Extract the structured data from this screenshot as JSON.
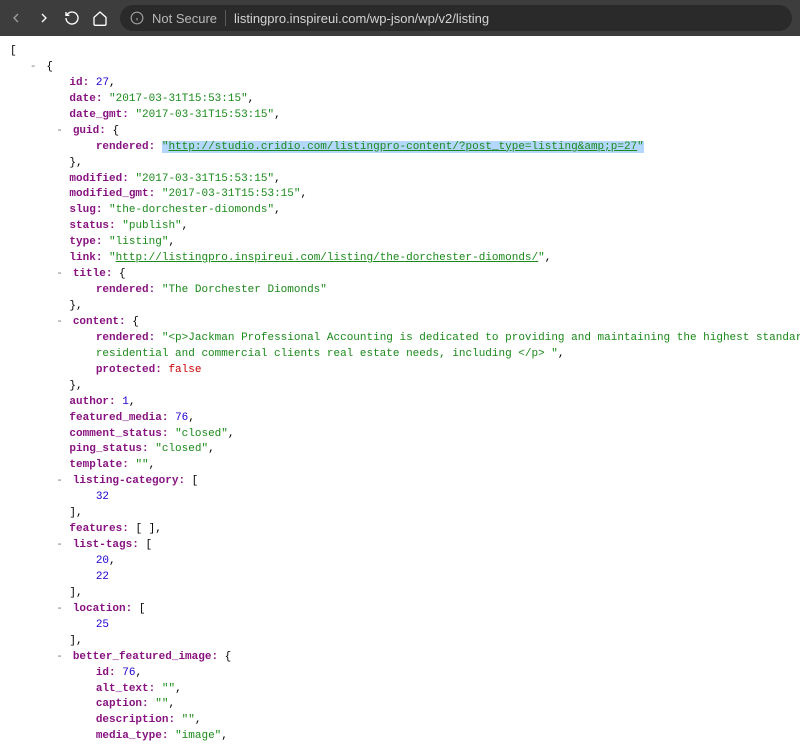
{
  "toolbar": {
    "secure_label": "Not Secure",
    "url": "listingpro.inspireui.com/wp-json/wp/v2/listing"
  },
  "json": {
    "id": 27,
    "date": "\"2017-03-31T15:53:15\"",
    "date_gmt": "\"2017-03-31T15:53:15\"",
    "guid_rendered_url": "http://studio.cridio.com/listingpro-content/?post_type=listing&amp;p=27",
    "modified": "\"2017-03-31T15:53:15\"",
    "modified_gmt": "\"2017-03-31T15:53:15\"",
    "slug": "\"the-dorchester-diomonds\"",
    "status": "\"publish\"",
    "type": "\"listing\"",
    "link_url": "http://listingpro.inspireui.com/listing/the-dorchester-diomonds/",
    "title_rendered": "\"The Dorchester Diomonds\"",
    "content_rendered": "\"<p>Jackman Professional Accounting is dedicated to providing and maintaining the highest standard of CPA and ac",
    "content_rendered_line2": "residential and commercial clients real estate needs, including </p> \"",
    "content_protected": "false",
    "author": 1,
    "featured_media": 76,
    "comment_status": "\"closed\"",
    "ping_status": "\"closed\"",
    "template": "\"\"",
    "listing_category_0": 32,
    "features": "[ ]",
    "list_tags_0": 20,
    "list_tags_1": 22,
    "location_0": 25,
    "bfi_id": 76,
    "bfi_alt_text": "\"\"",
    "bfi_caption": "\"\"",
    "bfi_description": "\"\"",
    "bfi_media_type": "\"image\""
  }
}
